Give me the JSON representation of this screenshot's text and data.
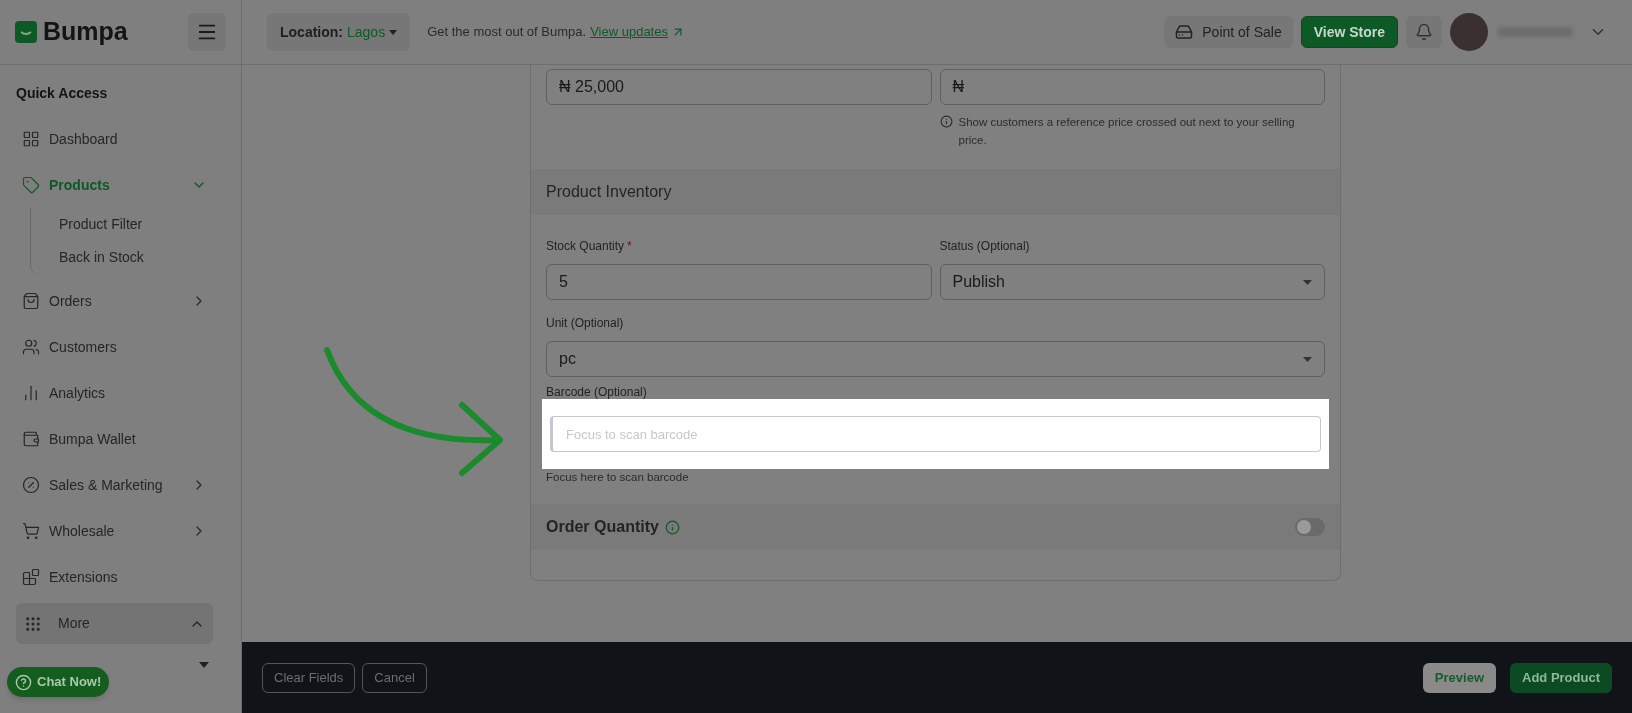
{
  "brand": {
    "name": "Bumpa"
  },
  "topbar": {
    "location_label": "Location:",
    "location_value": "Lagos",
    "promo_text": "Get the most out of Bumpa.",
    "promo_link": "View updates",
    "point_of_sale": "Point of Sale",
    "view_store": "View Store"
  },
  "sidebar": {
    "section_title": "Quick Access",
    "items": [
      {
        "label": "Dashboard",
        "selected": false
      },
      {
        "label": "Products",
        "selected": true,
        "expanded": true,
        "children": [
          {
            "label": "Product Filter",
            "selected": false
          },
          {
            "label": "Back in Stock",
            "selected": false
          }
        ]
      },
      {
        "label": "Orders",
        "selected": false,
        "expanded": false
      },
      {
        "label": "Customers",
        "selected": false
      },
      {
        "label": "Analytics",
        "selected": false
      },
      {
        "label": "Bumpa Wallet",
        "selected": false
      },
      {
        "label": "Sales & Marketing",
        "selected": false,
        "expanded": false
      },
      {
        "label": "Wholesale",
        "selected": false,
        "expanded": false
      },
      {
        "label": "Extensions",
        "selected": false
      }
    ],
    "more": {
      "label": "More",
      "expanded": true
    }
  },
  "chat": {
    "label": "Chat Now!"
  },
  "pricing": {
    "selling_price": "₦ 25,000",
    "compare_price": "₦",
    "compare_note": "Show customers a reference price crossed out next to your selling price."
  },
  "inventory": {
    "title": "Product Inventory",
    "stock_label": "Stock Quantity",
    "required_mark": "*",
    "stock_value": "5",
    "status_label": "Status (Optional)",
    "status_value": "Publish",
    "unit_label": "Unit (Optional)",
    "unit_value": "pc",
    "barcode_label": "Barcode (Optional)",
    "barcode_placeholder": "Focus to scan barcode",
    "barcode_hint": "Focus here to scan barcode"
  },
  "order_quantity": {
    "title": "Order Quantity",
    "on": false
  },
  "footer": {
    "clear": "Clear Fields",
    "cancel": "Cancel",
    "preview": "Preview",
    "add": "Add Product"
  }
}
